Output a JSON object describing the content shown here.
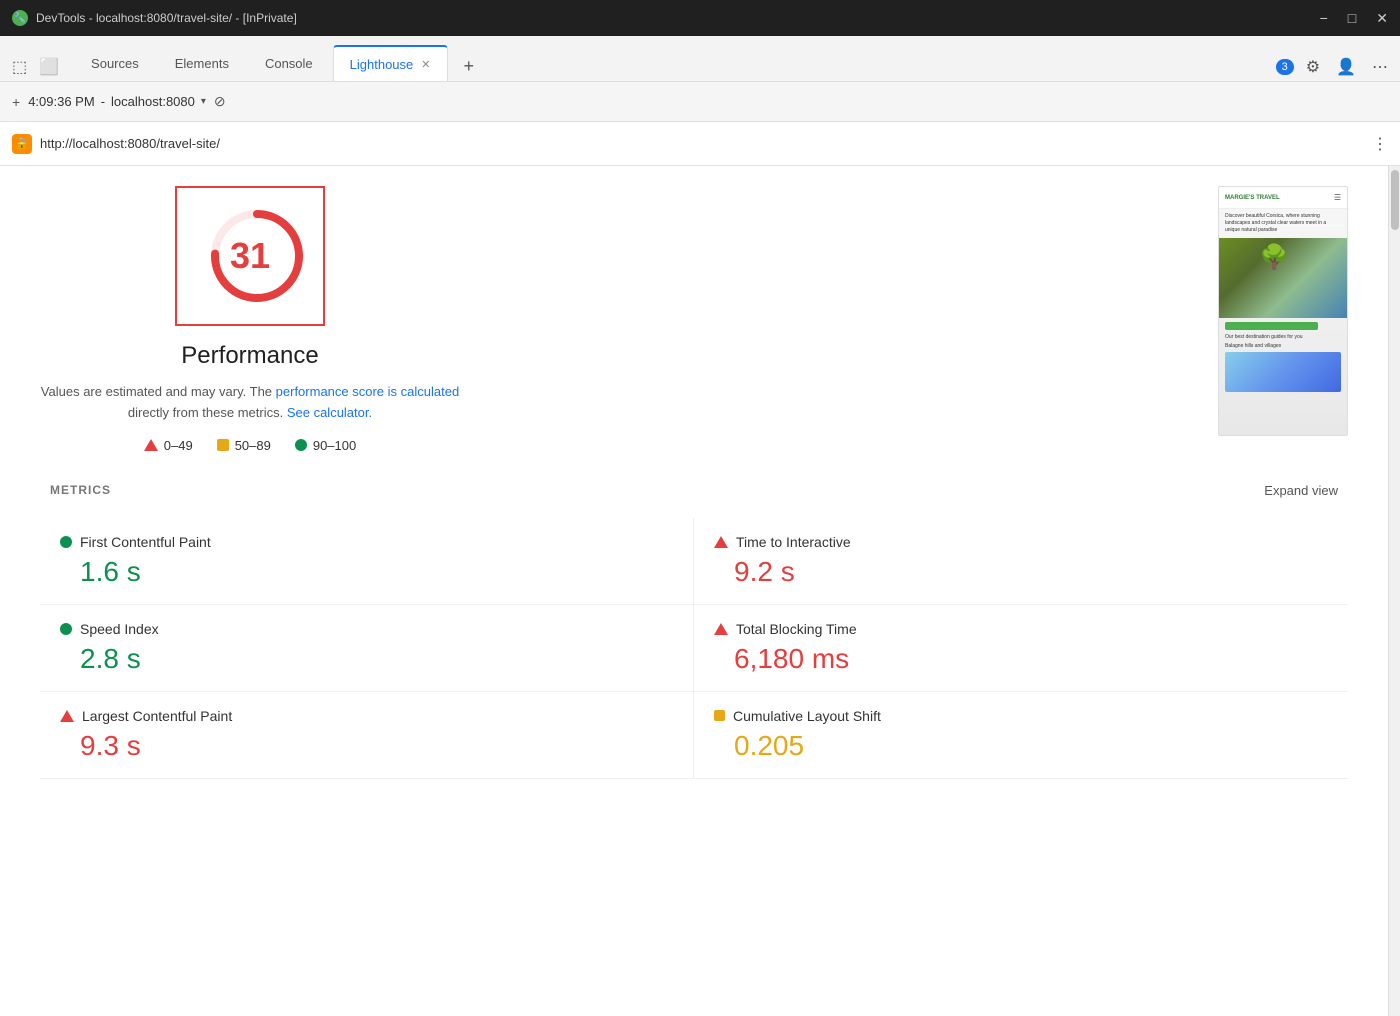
{
  "titleBar": {
    "icon": "🔧",
    "title": "DevTools - localhost:8080/travel-site/ - [InPrivate]",
    "controls": [
      "−",
      "□",
      "✕"
    ]
  },
  "tabs": {
    "items": [
      {
        "id": "sources",
        "label": "Sources",
        "active": false
      },
      {
        "id": "elements",
        "label": "Elements",
        "active": false
      },
      {
        "id": "console",
        "label": "Console",
        "active": false
      },
      {
        "id": "lighthouse",
        "label": "Lighthouse",
        "active": true
      }
    ],
    "addLabel": "+",
    "badgeCount": "3"
  },
  "urlBar": {
    "time": "4:09:36 PM",
    "url": "localhost:8080",
    "stopIcon": "⊘"
  },
  "addressBar": {
    "url": "http://localhost:8080/travel-site/",
    "moreIcon": "⋮"
  },
  "performance": {
    "score": "31",
    "title": "Performance",
    "description": "Values are estimated and may vary. The",
    "link1Text": "performance score is calculated",
    "descMiddle": "directly from these metrics.",
    "link2Text": "See calculator.",
    "legend": [
      {
        "type": "triangle",
        "range": "0–49"
      },
      {
        "type": "square",
        "range": "50–89"
      },
      {
        "type": "circle",
        "range": "90–100"
      }
    ]
  },
  "metrics": {
    "title": "METRICS",
    "expandLabel": "Expand view",
    "items": [
      {
        "id": "fcp",
        "label": "First Contentful Paint",
        "value": "1.6 s",
        "type": "green",
        "col": "left"
      },
      {
        "id": "tti",
        "label": "Time to Interactive",
        "value": "9.2 s",
        "type": "red",
        "col": "right"
      },
      {
        "id": "si",
        "label": "Speed Index",
        "value": "2.8 s",
        "type": "green",
        "col": "left"
      },
      {
        "id": "tbt",
        "label": "Total Blocking Time",
        "value": "6,180 ms",
        "type": "red",
        "col": "right"
      },
      {
        "id": "lcp",
        "label": "Largest Contentful Paint",
        "value": "9.3 s",
        "type": "red",
        "col": "left"
      },
      {
        "id": "cls",
        "label": "Cumulative Layout Shift",
        "value": "0.205",
        "type": "orange",
        "col": "right"
      }
    ]
  }
}
